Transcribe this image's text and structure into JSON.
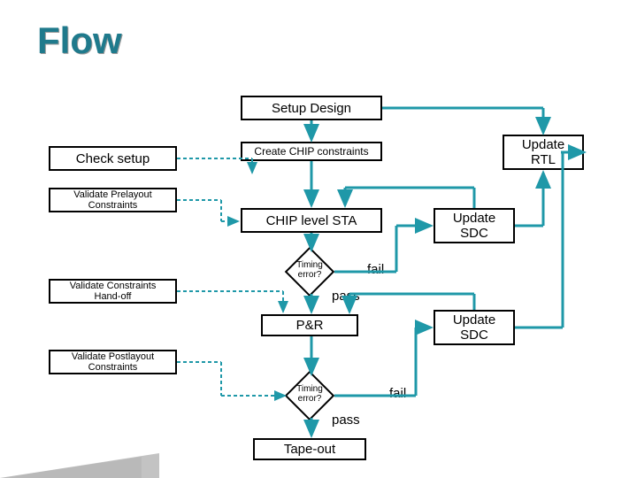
{
  "title": "Flow",
  "boxes": {
    "setup_design": "Setup Design",
    "check_setup": "Check setup",
    "create_chip_constraints": "Create CHIP constraints",
    "update_rtl": "Update RTL",
    "validate_prelayout": "Validate Prelayout Constraints",
    "chip_level_sta": "CHIP level STA",
    "update_sdc1": "Update SDC",
    "validate_handoff": "Validate Constraints Hand-off",
    "pr": "P&R",
    "update_sdc2": "Update SDC",
    "validate_postlayout": "Validate Postlayout Constraints",
    "tapeout": "Tape-out"
  },
  "decisions": {
    "timing_error1": "Timing error?",
    "timing_error2": "Timing error?"
  },
  "labels": {
    "fail1": "fail",
    "pass1": "pass",
    "fail2": "fail",
    "pass2": "pass"
  }
}
